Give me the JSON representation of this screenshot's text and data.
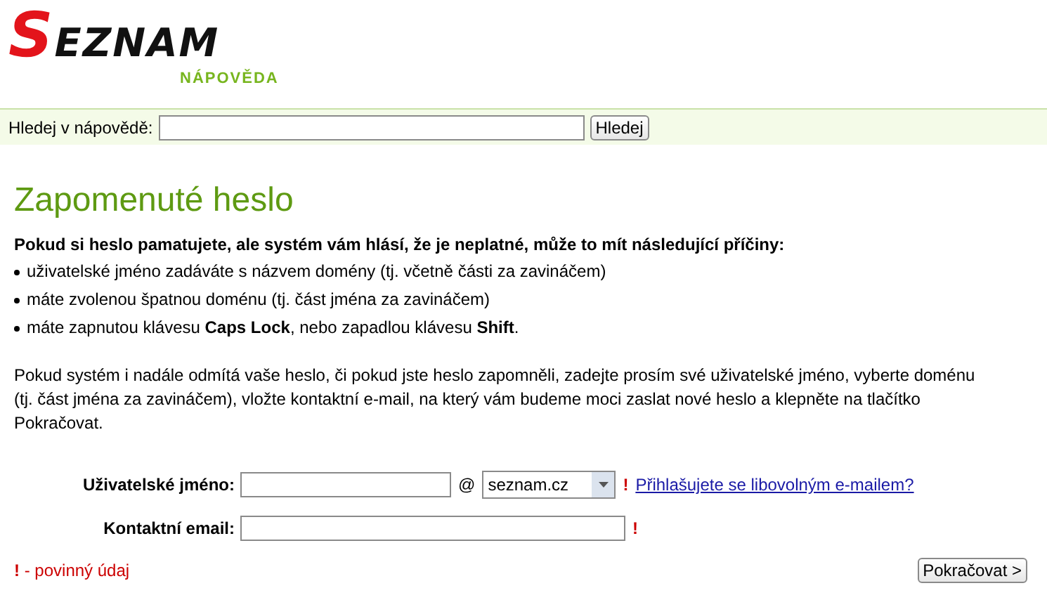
{
  "logo": {
    "wordmark": "SEZNAM",
    "subtitle": "NÁPOVĚDA"
  },
  "search": {
    "label": "Hledej v nápovědě:",
    "button": "Hledej"
  },
  "heading": "Zapomenuté heslo",
  "intro": "Pokud si heslo pamatujete, ale systém vám hlásí, že je neplatné, může to mít následující příčiny:",
  "causes": [
    "uživatelské jméno zadáváte s názvem domény (tj. včetně části za zavináčem)",
    "máte zvolenou špatnou doménu (tj. část jména za zavináčem)",
    "máte zapnutou klávesu **Caps Lock**, nebo zapadlou klávesu **Shift**."
  ],
  "instructions": "Pokud systém i nadále odmítá vaše heslo, či pokud jste heslo zapomněli, zadejte prosím své uživatelské jméno, vyberte doménu (tj. část jména za zavináčem), vložte kontaktní e-mail, na který vám budeme moci zaslat nové heslo a klepněte na tlačítko Pokračovat.",
  "form": {
    "username_label": "Uživatelské jméno:",
    "at": "@",
    "domain": "seznam.cz",
    "username_required": "!",
    "link": "Přihlašujete se libovolným e-mailem?",
    "email_label": "Kontaktní email:",
    "email_required": "!"
  },
  "legend": {
    "mark": "!",
    "text": "- povinný údaj"
  },
  "continue_button": "Pokračovat >"
}
